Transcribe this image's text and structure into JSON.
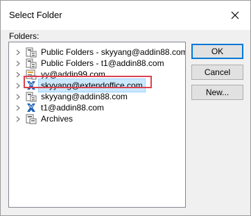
{
  "window": {
    "title": "Select Folder"
  },
  "folders_label": "Folders:",
  "tree": {
    "items": [
      {
        "label": "Public Folders - skyyang@addin88.com",
        "icon": "public-folders-icon",
        "selected": false
      },
      {
        "label": "Public Folders - t1@addin88.com",
        "icon": "public-folders-icon",
        "selected": false
      },
      {
        "label": "yy@addin99.com",
        "icon": "mailbox-icon",
        "selected": false
      },
      {
        "label": "skyyang@extendoffice.com",
        "icon": "exchange-mailbox-icon",
        "selected": true
      },
      {
        "label": "skyyang@addin88.com",
        "icon": "public-folders-icon",
        "selected": false
      },
      {
        "label": "t1@addin88.com",
        "icon": "exchange-mailbox-icon",
        "selected": false
      },
      {
        "label": "Archives",
        "icon": "archive-folder-icon",
        "selected": false
      }
    ]
  },
  "buttons": {
    "ok": "OK",
    "cancel": "Cancel",
    "new": "New..."
  },
  "colors": {
    "selection": "#cce8ff",
    "highlight_border": "#d9424f",
    "exchange_blue": "#1f5fb5"
  }
}
